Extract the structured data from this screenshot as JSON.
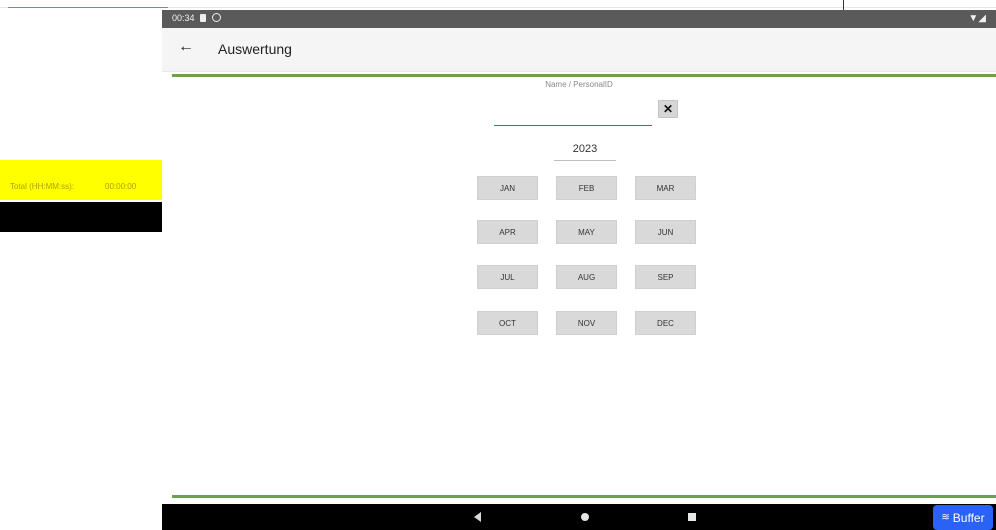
{
  "background_app": {
    "total_label": "Total (HH:MM:ss):",
    "total_value": "00:00:00"
  },
  "statusbar": {
    "time": "00:34"
  },
  "appbar": {
    "back_icon": "arrow-left",
    "title": "Auswertung"
  },
  "form": {
    "name_label": "Name / PersonalID",
    "name_value": "",
    "clear_label": "✕",
    "year": "2023"
  },
  "months": [
    "JAN",
    "FEB",
    "MAR",
    "APR",
    "MAY",
    "JUN",
    "JUL",
    "AUG",
    "SEP",
    "OCT",
    "NOV",
    "DEC"
  ],
  "buffer": {
    "label": "Buffer"
  },
  "colors": {
    "accent_green": "#6ea24a",
    "input_underline": "#1d8a88",
    "buffer_blue": "#2a62f5",
    "highlight_yellow": "#ffff00"
  }
}
